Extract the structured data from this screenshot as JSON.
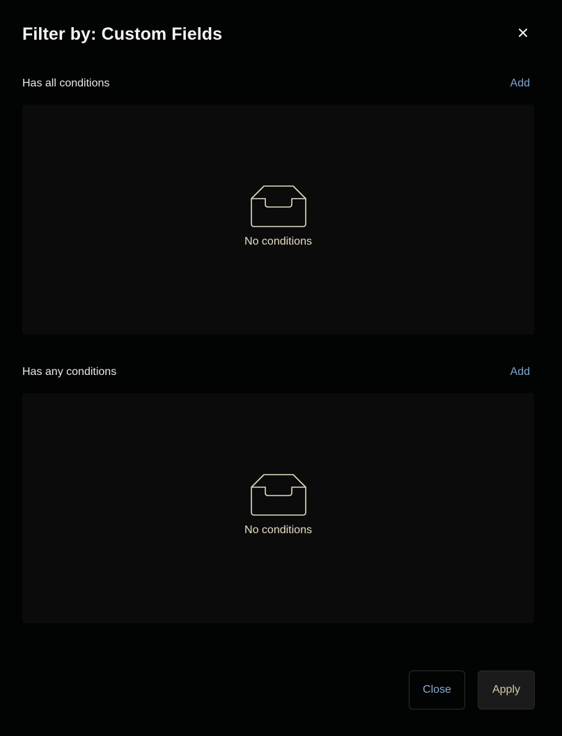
{
  "modal": {
    "title": "Filter by: Custom Fields",
    "close_icon": "close-icon"
  },
  "sections": [
    {
      "label": "Has all conditions",
      "add_label": "Add",
      "empty_icon": "inbox-tray-icon",
      "empty_text": "No conditions"
    },
    {
      "label": "Has any conditions",
      "add_label": "Add",
      "empty_icon": "inbox-tray-icon",
      "empty_text": "No conditions"
    }
  ],
  "footer": {
    "close_label": "Close",
    "apply_label": "Apply"
  },
  "colors": {
    "background": "#020303",
    "panel": "#0b0b0b",
    "link_accent": "#7fa7d4",
    "empty_text": "#e6dcc4",
    "apply_text": "#d8c9a8"
  }
}
